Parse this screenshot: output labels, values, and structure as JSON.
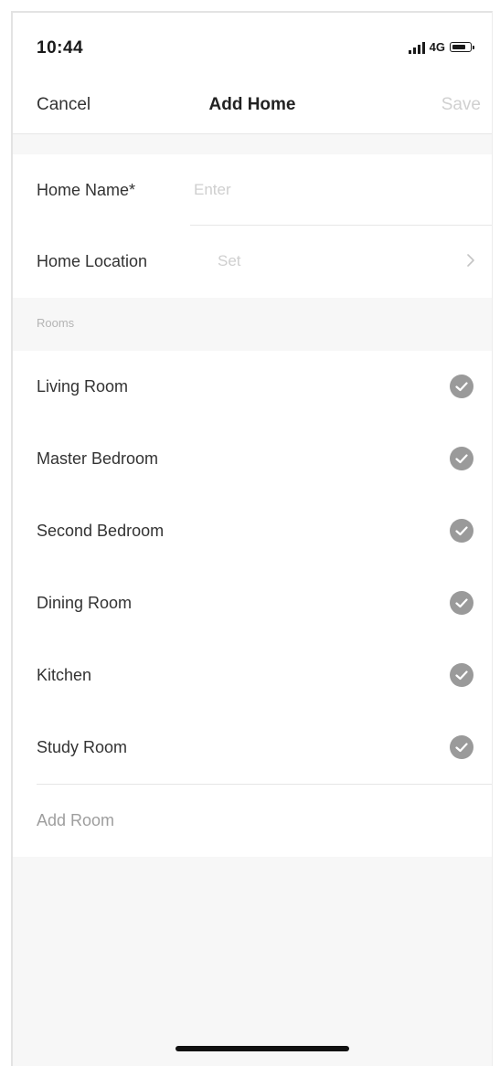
{
  "status_bar": {
    "time": "10:44",
    "network": "4G"
  },
  "nav": {
    "cancel_label": "Cancel",
    "title": "Add Home",
    "save_label": "Save"
  },
  "form": {
    "home_name_label": "Home Name*",
    "home_name_placeholder": "Enter",
    "home_location_label": "Home Location",
    "home_location_value": "Set"
  },
  "rooms_section": {
    "header": "Rooms",
    "items": [
      {
        "label": "Living Room",
        "checked": true
      },
      {
        "label": "Master Bedroom",
        "checked": true
      },
      {
        "label": "Second Bedroom",
        "checked": true
      },
      {
        "label": "Dining Room",
        "checked": true
      },
      {
        "label": "Kitchen",
        "checked": true
      },
      {
        "label": "Study Room",
        "checked": true
      }
    ],
    "add_room_label": "Add Room"
  },
  "colors": {
    "check_fill": "#9a9a9a",
    "background": "#f7f7f7"
  },
  "icons": {
    "check": "check-circle-icon",
    "chevron": "chevron-right-icon"
  }
}
